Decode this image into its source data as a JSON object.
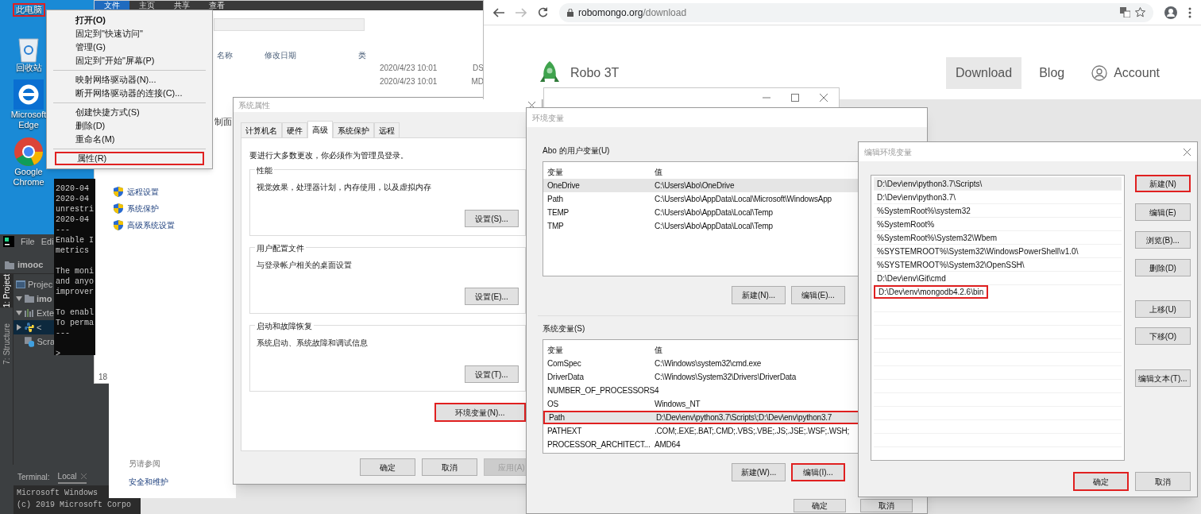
{
  "desktop": {
    "icons": [
      {
        "kind": "computer",
        "label": "此电脑",
        "highlighted": true
      },
      {
        "kind": "recycle",
        "label": "回收站",
        "highlighted": false
      },
      {
        "kind": "edge",
        "label": "Microsoft Edge",
        "highlighted": false
      },
      {
        "kind": "chrome",
        "label": "Google Chrome",
        "highlighted": false
      }
    ]
  },
  "file_explorer": {
    "ribbon_tabs": [
      {
        "label": "文件",
        "selected": true
      },
      {
        "label": "主页",
        "selected": false
      },
      {
        "label": "共享",
        "selected": false
      },
      {
        "label": "查看",
        "selected": false
      }
    ],
    "columns": [
      "名称",
      "修改日期",
      "类"
    ],
    "rows": [
      {
        "date": "2020/4/23 10:01",
        "type": "DS"
      },
      {
        "date": "2020/4/23 10:01",
        "type": "MD"
      }
    ],
    "status": "18"
  },
  "control_panel": {
    "header": "制面",
    "tasks": [
      "远程设置",
      "系统保护",
      "高级系统设置"
    ],
    "see_also_title": "另请参阅",
    "see_also_links": [
      "安全和维护"
    ]
  },
  "console": {
    "blocks": [
      [
        "2020-04",
        "2020-04",
        "unrestri",
        "2020-04",
        "---",
        "Enable I",
        "metrics"
      ],
      [
        "The moni",
        "and anyo",
        "improver"
      ],
      [
        "To enabl",
        "To perma",
        "---"
      ]
    ],
    "prompt": ">"
  },
  "pycharm": {
    "menu": [
      "File",
      "Edi"
    ],
    "project": "imooc",
    "tool_tabs": [
      {
        "label": "1: Project",
        "selected": true
      },
      {
        "label": "7: Structure",
        "selected": false
      }
    ],
    "tree": [
      {
        "kind": "header",
        "label": "Projec",
        "selected": false
      },
      {
        "kind": "folder",
        "label": "imo",
        "selected": false,
        "expanded": true
      },
      {
        "kind": "library",
        "label": "Exte",
        "selected": false,
        "expanded": true
      },
      {
        "kind": "python",
        "label": "<",
        "selected": true,
        "expanded": false
      },
      {
        "kind": "scratch",
        "label": "Scra",
        "selected": false
      }
    ],
    "terminal": {
      "title": "Terminal:",
      "tab": "Local",
      "lines": [
        "Microsoft Windows",
        "(c) 2019 Microsoft Corpo"
      ]
    }
  },
  "context_menu": {
    "groups": [
      [
        {
          "label": "打开(O)",
          "kind": "default",
          "highlighted": false
        },
        {
          "label": "固定到\"快速访问\"",
          "kind": "item",
          "highlighted": false
        },
        {
          "label": "管理(G)",
          "kind": "item",
          "highlighted": false
        },
        {
          "label": "固定到\"开始\"屏幕(P)",
          "kind": "item",
          "highlighted": false
        }
      ],
      [
        {
          "label": "映射网络驱动器(N)...",
          "kind": "item",
          "highlighted": false
        },
        {
          "label": "断开网络驱动器的连接(C)...",
          "kind": "item",
          "highlighted": false
        }
      ],
      [
        {
          "label": "创建快捷方式(S)",
          "kind": "item",
          "highlighted": false
        },
        {
          "label": "删除(D)",
          "kind": "item",
          "highlighted": false
        },
        {
          "label": "重命名(M)",
          "kind": "item",
          "highlighted": false
        }
      ],
      [
        {
          "label": "属性(R)",
          "kind": "item",
          "highlighted": true
        }
      ]
    ]
  },
  "system_properties": {
    "title": "系统属性",
    "tabs": [
      {
        "label": "计算机名",
        "selected": false
      },
      {
        "label": "硬件",
        "selected": false
      },
      {
        "label": "高级",
        "selected": true
      },
      {
        "label": "系统保护",
        "selected": false
      },
      {
        "label": "远程",
        "selected": false
      }
    ],
    "notice": "要进行大多数更改，你必须作为管理员登录。",
    "groups": [
      {
        "title": "性能",
        "description": "视觉效果，处理器计划，内存使用，以及虚拟内存",
        "button": "设置(S)..."
      },
      {
        "title": "用户配置文件",
        "description": "与登录帐户相关的桌面设置",
        "button": "设置(E)..."
      },
      {
        "title": "启动和故障恢复",
        "description": "系统启动、系统故障和调试信息",
        "button": "设置(T)..."
      }
    ],
    "env_button": {
      "label": "环境变量(N)...",
      "highlighted": true
    },
    "footer": [
      {
        "label": "确定",
        "disabled": false
      },
      {
        "label": "取消",
        "disabled": false
      },
      {
        "label": "应用(A)",
        "disabled": true
      }
    ]
  },
  "browser": {
    "url_host": "robomongo.org",
    "url_path": "/download",
    "site_name": "Robo 3T",
    "nav": [
      {
        "kind": "link",
        "label": "Download",
        "selected": true
      },
      {
        "kind": "link",
        "label": "Blog",
        "selected": false
      },
      {
        "kind": "account",
        "label": "Account",
        "selected": false
      }
    ]
  },
  "environment_variables": {
    "title": "环境变量",
    "user_section": "Abo 的用户变量(U)",
    "user_columns": [
      "变量",
      "值"
    ],
    "user_vars": [
      {
        "name": "OneDrive",
        "value": "C:\\Users\\Abo\\OneDrive",
        "selected": true
      },
      {
        "name": "Path",
        "value": "C:\\Users\\Abo\\AppData\\Local\\Microsoft\\WindowsApp",
        "selected": false
      },
      {
        "name": "TEMP",
        "value": "C:\\Users\\Abo\\AppData\\Local\\Temp",
        "selected": false
      },
      {
        "name": "TMP",
        "value": "C:\\Users\\Abo\\AppData\\Local\\Temp",
        "selected": false
      }
    ],
    "user_buttons": [
      {
        "label": "新建(N)...",
        "highlighted": false
      },
      {
        "label": "编辑(E)...",
        "highlighted": false
      }
    ],
    "system_section": "系统变量(S)",
    "system_columns": [
      "变量",
      "值"
    ],
    "system_vars": [
      {
        "name": "ComSpec",
        "value": "C:\\Windows\\system32\\cmd.exe",
        "selected": false,
        "highlighted": false
      },
      {
        "name": "DriverData",
        "value": "C:\\Windows\\System32\\Drivers\\DriverData",
        "selected": false,
        "highlighted": false
      },
      {
        "name": "NUMBER_OF_PROCESSORS",
        "value": "4",
        "selected": false,
        "highlighted": false
      },
      {
        "name": "OS",
        "value": "Windows_NT",
        "selected": false,
        "highlighted": false
      },
      {
        "name": "Path",
        "value": "D:\\Dev\\env\\python3.7\\Scripts\\;D:\\Dev\\env\\python3.7",
        "selected": true,
        "highlighted": true
      },
      {
        "name": "PATHEXT",
        "value": ".COM;.EXE;.BAT;.CMD;.VBS;.VBE;.JS;.JSE;.WSF;.WSH;",
        "selected": false,
        "highlighted": false
      },
      {
        "name": "PROCESSOR_ARCHITECT...",
        "value": "AMD64",
        "selected": false,
        "highlighted": false
      }
    ],
    "system_buttons": [
      {
        "label": "新建(W)...",
        "highlighted": false
      },
      {
        "label": "编辑(I)...",
        "highlighted": true
      }
    ],
    "footer": [
      "确定",
      "取消"
    ]
  },
  "edit_variable": {
    "title": "编辑环境变量",
    "entries": [
      {
        "value": "D:\\Dev\\env\\python3.7\\Scripts\\",
        "selected": true,
        "highlighted": false
      },
      {
        "value": "D:\\Dev\\env\\python3.7\\",
        "selected": false,
        "highlighted": false
      },
      {
        "value": "%SystemRoot%\\system32",
        "selected": false,
        "highlighted": false
      },
      {
        "value": "%SystemRoot%",
        "selected": false,
        "highlighted": false
      },
      {
        "value": "%SystemRoot%\\System32\\Wbem",
        "selected": false,
        "highlighted": false
      },
      {
        "value": "%SYSTEMROOT%\\System32\\WindowsPowerShell\\v1.0\\",
        "selected": false,
        "highlighted": false
      },
      {
        "value": "%SYSTEMROOT%\\System32\\OpenSSH\\",
        "selected": false,
        "highlighted": false
      },
      {
        "value": "D:\\Dev\\env\\Git\\cmd",
        "selected": false,
        "highlighted": false
      },
      {
        "value": "D:\\Dev\\env\\mongodb4.2.6\\bin",
        "selected": false,
        "highlighted": true
      }
    ],
    "buttons": [
      {
        "label": "新建(N)",
        "highlighted": true
      },
      {
        "label": "编辑(E)",
        "highlighted": false
      },
      {
        "label": "浏览(B)...",
        "highlighted": false
      },
      {
        "label": "删除(D)",
        "highlighted": false
      },
      {
        "label": "上移(U)",
        "highlighted": false
      },
      {
        "label": "下移(O)",
        "highlighted": false
      },
      {
        "label": "编辑文本(T)...",
        "highlighted": false
      }
    ],
    "footer": [
      {
        "label": "确定",
        "highlighted": true
      },
      {
        "label": "取消",
        "highlighted": false
      }
    ]
  }
}
